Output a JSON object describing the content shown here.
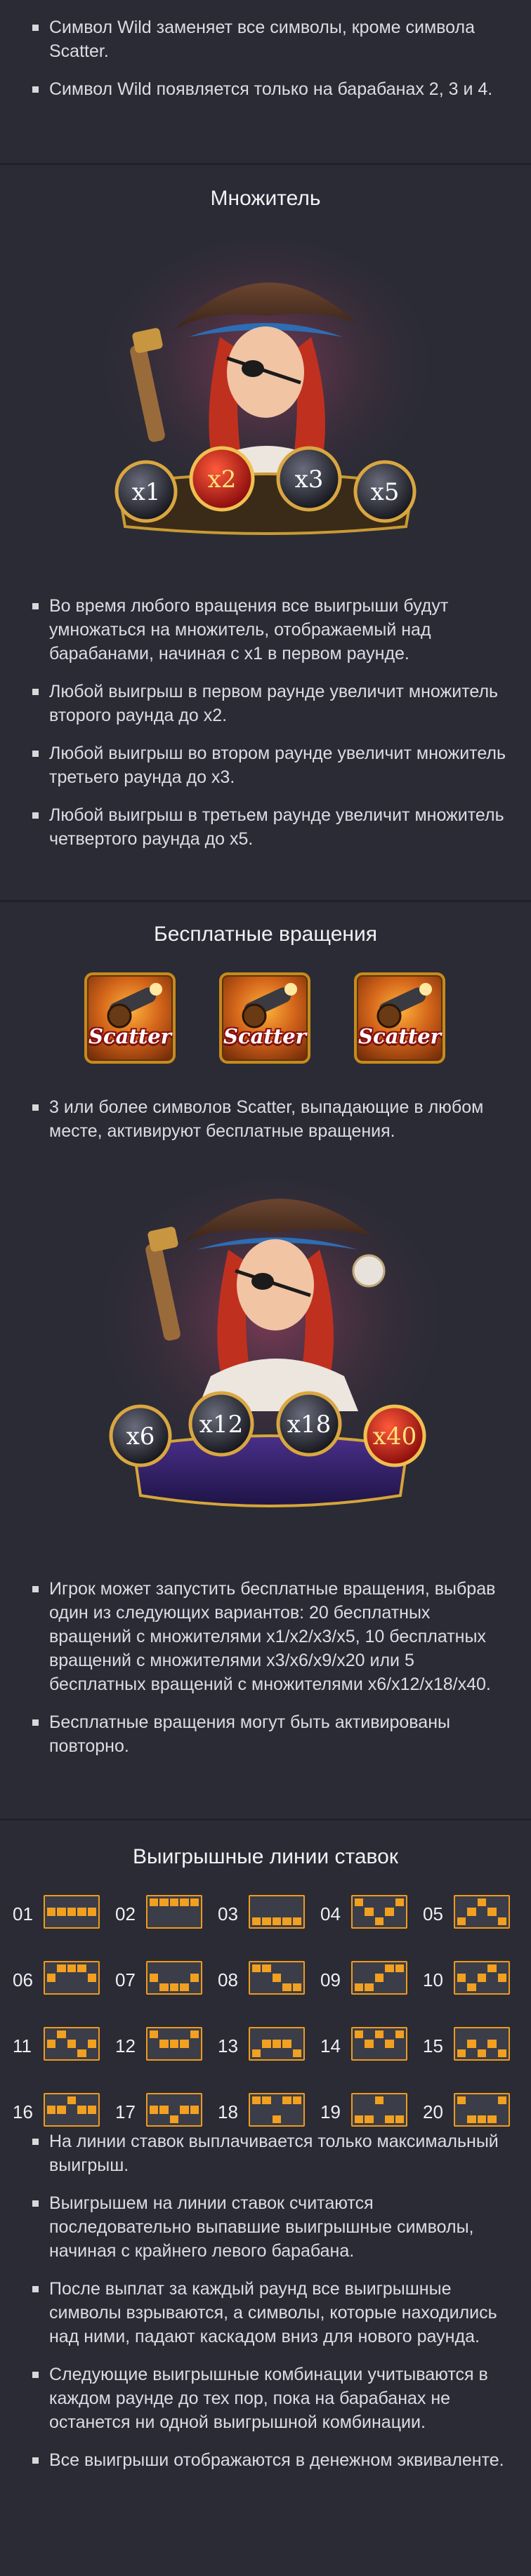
{
  "wild_bullets": [
    "Символ Wild заменяет все символы, кроме символа Scatter.",
    "Символ Wild появляется только на барабанах 2, 3 и 4."
  ],
  "multiplier": {
    "title": "Множитель",
    "badges": [
      "x1",
      "x2",
      "x3",
      "x5"
    ],
    "bullets": [
      "Во время любого вращения все выигрыши будут умножаться на множитель, отображаемый над барабанами, начиная с x1 в первом раунде.",
      "Любой выигрыш в первом раунде увеличит множитель второго раунда до x2.",
      "Любой выигрыш во втором раунде увеличит множитель третьего раунда до x3.",
      "Любой выигрыш в третьем раунде увеличит множитель четвертого раунда до x5."
    ]
  },
  "free_spins": {
    "title": "Бесплатные вращения",
    "scatter_label": "Scatter",
    "bullets1": [
      "3 или более символов Scatter, выпадающие в любом месте, активируют бесплатные вращения."
    ],
    "badges": [
      "x6",
      "x12",
      "x18",
      "x40"
    ],
    "bullets2": [
      "Игрок может запустить бесплатные вращения, выбрав один из следующих вариантов: 20 бесплатных вращений с множителями x1/x2/x3/x5, 10 бесплатных вращений с множителями x3/x6/x9/x20 или 5 бесплатных вращений с множителями x6/x12/x18/x40.",
      "Бесплатные вращения могут быть активированы повторно."
    ]
  },
  "paylines": {
    "title": "Выигрышные линии ставок",
    "lines": [
      {
        "num": "01",
        "rows": [
          1,
          1,
          1,
          1,
          1
        ]
      },
      {
        "num": "02",
        "rows": [
          0,
          0,
          0,
          0,
          0
        ]
      },
      {
        "num": "03",
        "rows": [
          2,
          2,
          2,
          2,
          2
        ]
      },
      {
        "num": "04",
        "rows": [
          0,
          1,
          2,
          1,
          0
        ]
      },
      {
        "num": "05",
        "rows": [
          2,
          1,
          0,
          1,
          2
        ]
      },
      {
        "num": "06",
        "rows": [
          1,
          0,
          0,
          0,
          1
        ]
      },
      {
        "num": "07",
        "rows": [
          1,
          2,
          2,
          2,
          1
        ]
      },
      {
        "num": "08",
        "rows": [
          0,
          0,
          1,
          2,
          2
        ]
      },
      {
        "num": "09",
        "rows": [
          2,
          2,
          1,
          0,
          0
        ]
      },
      {
        "num": "10",
        "rows": [
          1,
          2,
          1,
          0,
          1
        ]
      },
      {
        "num": "11",
        "rows": [
          1,
          0,
          1,
          2,
          1
        ]
      },
      {
        "num": "12",
        "rows": [
          0,
          1,
          1,
          1,
          0
        ]
      },
      {
        "num": "13",
        "rows": [
          2,
          1,
          1,
          1,
          2
        ]
      },
      {
        "num": "14",
        "rows": [
          0,
          1,
          0,
          1,
          0
        ]
      },
      {
        "num": "15",
        "rows": [
          2,
          1,
          2,
          1,
          2
        ]
      },
      {
        "num": "16",
        "rows": [
          1,
          1,
          0,
          1,
          1
        ]
      },
      {
        "num": "17",
        "rows": [
          1,
          1,
          2,
          1,
          1
        ]
      },
      {
        "num": "18",
        "rows": [
          0,
          0,
          2,
          0,
          0
        ]
      },
      {
        "num": "19",
        "rows": [
          2,
          2,
          0,
          2,
          2
        ]
      },
      {
        "num": "20",
        "rows": [
          0,
          2,
          2,
          2,
          0
        ]
      }
    ],
    "bullets": [
      "На линии ставок выплачивается только максимальный выигрыш.",
      "Выигрышем на линии ставок считаются последовательно выпавшие выигрышные символы, начиная с крайнего левого барабана.",
      "После выплат за каждый раунд все выигрышные символы взрываются, а символы, которые находились над ними, падают каскадом вниз для нового раунда.",
      "Следующие выигрышные комбинации учитываются в каждом раунде до тех пор, пока на барабанах не останется ни одной выигрышной комбинации.",
      "Все выигрыши отображаются в денежном эквиваленте."
    ]
  },
  "colors": {
    "background": "#2a2b35",
    "separator": "#20212a",
    "accent": "#f2a020",
    "text": "#dcdde3"
  }
}
